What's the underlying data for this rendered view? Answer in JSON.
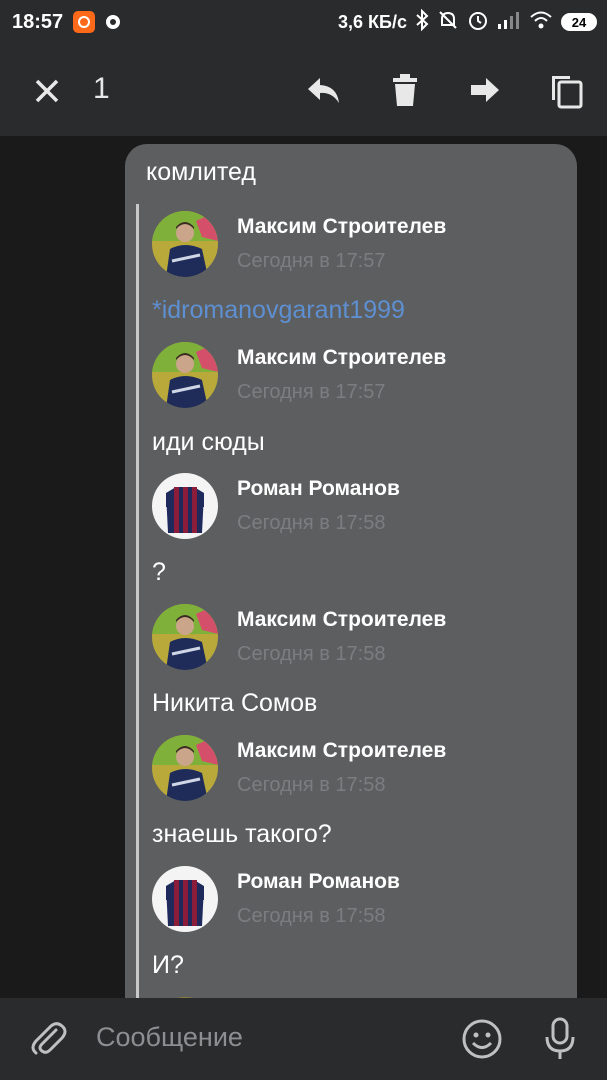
{
  "status_bar": {
    "time": "18:57",
    "net_speed": "3,6 КБ/с",
    "battery": "24",
    "icons": [
      "app-notification-icon",
      "sync-icon",
      "bluetooth-icon",
      "mute-icon",
      "alarm-icon",
      "signal-icon",
      "wifi-icon",
      "battery-icon"
    ]
  },
  "action_bar": {
    "selected_count": "1",
    "icons": [
      "close-icon",
      "reply-icon",
      "delete-icon",
      "forward-icon",
      "copy-icon"
    ]
  },
  "message": {
    "text": "комлитед",
    "forwarded": [
      {
        "author": "Максим Строителев",
        "time": "Сегодня в 17:57",
        "text": "*idromanovgarant1999",
        "is_link": true,
        "avatar": "photo-person"
      },
      {
        "author": "Максим Строителев",
        "time": "Сегодня в 17:57",
        "text": "иди сюды",
        "avatar": "photo-person"
      },
      {
        "author": "Роман Романов",
        "time": "Сегодня в 17:58",
        "text": "?",
        "avatar": "jersey"
      },
      {
        "author": "Максим Строителев",
        "time": "Сегодня в 17:58",
        "text": "Никита Сомов",
        "avatar": "photo-person"
      },
      {
        "author": "Максим Строителев",
        "time": "Сегодня в 17:58",
        "text": "знаешь такого?",
        "avatar": "photo-person"
      },
      {
        "author": "Роман Романов",
        "time": "Сегодня в 17:58",
        "text": "И?",
        "avatar": "jersey"
      }
    ]
  },
  "composer": {
    "placeholder": "Сообщение",
    "icons": [
      "attach-icon",
      "emoji-icon",
      "mic-icon"
    ]
  },
  "colors": {
    "bar_bg": "#2a2b2c",
    "bubble_bg": "#5d5e60",
    "link": "#5e8fd0",
    "time_text": "#7c7d80"
  }
}
